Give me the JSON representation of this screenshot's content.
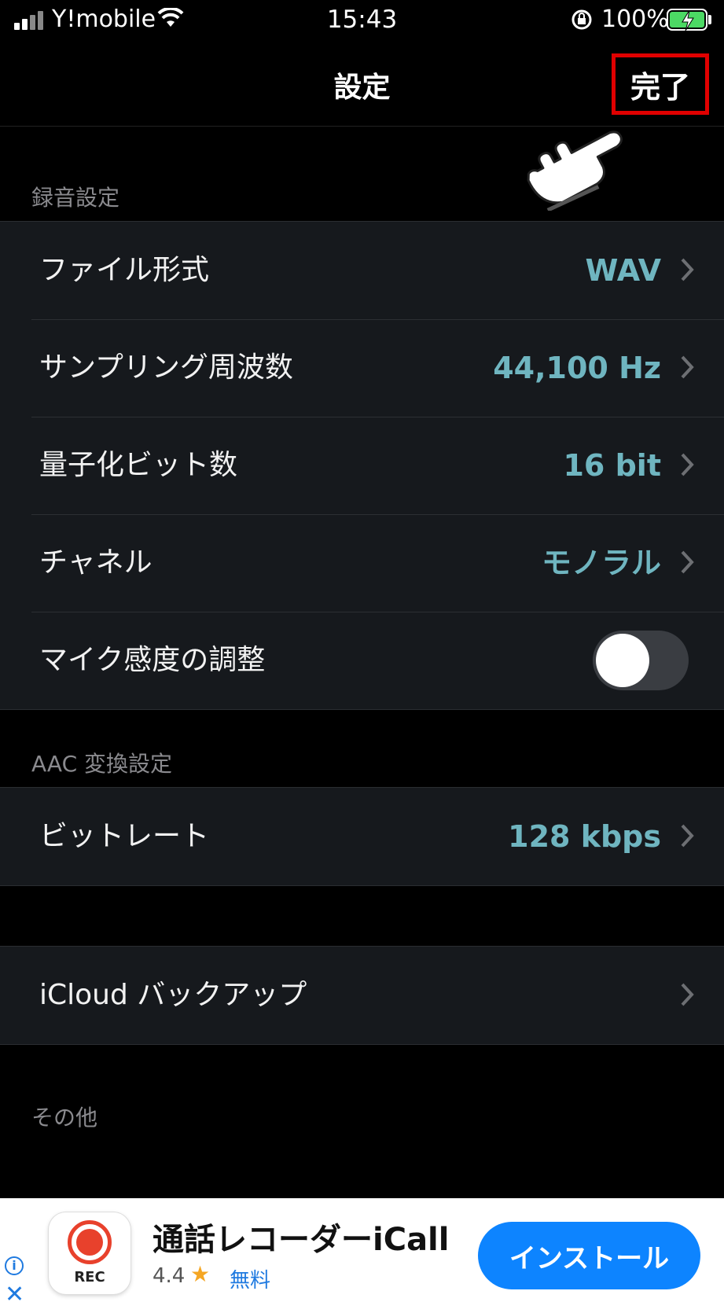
{
  "status_bar": {
    "carrier": "Y!mobile",
    "time": "15:43",
    "battery": "100%",
    "icons": [
      "signal-icon",
      "wifi-icon",
      "orientation-lock-icon",
      "battery-charging-icon"
    ]
  },
  "nav": {
    "title": "設定",
    "done_label": "完了"
  },
  "sections": {
    "recording": {
      "header": "録音設定",
      "rows": [
        {
          "label": "ファイル形式",
          "value": "WAV"
        },
        {
          "label": "サンプリング周波数",
          "value": "44,100 Hz"
        },
        {
          "label": "量子化ビット数",
          "value": "16 bit"
        },
        {
          "label": "チャネル",
          "value": "モノラル"
        },
        {
          "label": "マイク感度の調整",
          "toggle": false
        }
      ]
    },
    "aac": {
      "header": "AAC 変換設定",
      "rows": [
        {
          "label": "ビットレート",
          "value": "128 kbps"
        }
      ]
    },
    "backup": {
      "rows": [
        {
          "label": "iCloud バックアップ"
        }
      ]
    },
    "other": {
      "header": "その他"
    }
  },
  "ad": {
    "app_icon_text": "REC",
    "title": "通話レコーダーiCall",
    "rating": "4.4",
    "price": "無料",
    "install_label": "インストール",
    "info_symbol": "i",
    "close_symbol": "✕"
  },
  "colors": {
    "accent_value": "#6fb5c0",
    "highlight_box": "#e00000",
    "install_button": "#0d84ff"
  }
}
